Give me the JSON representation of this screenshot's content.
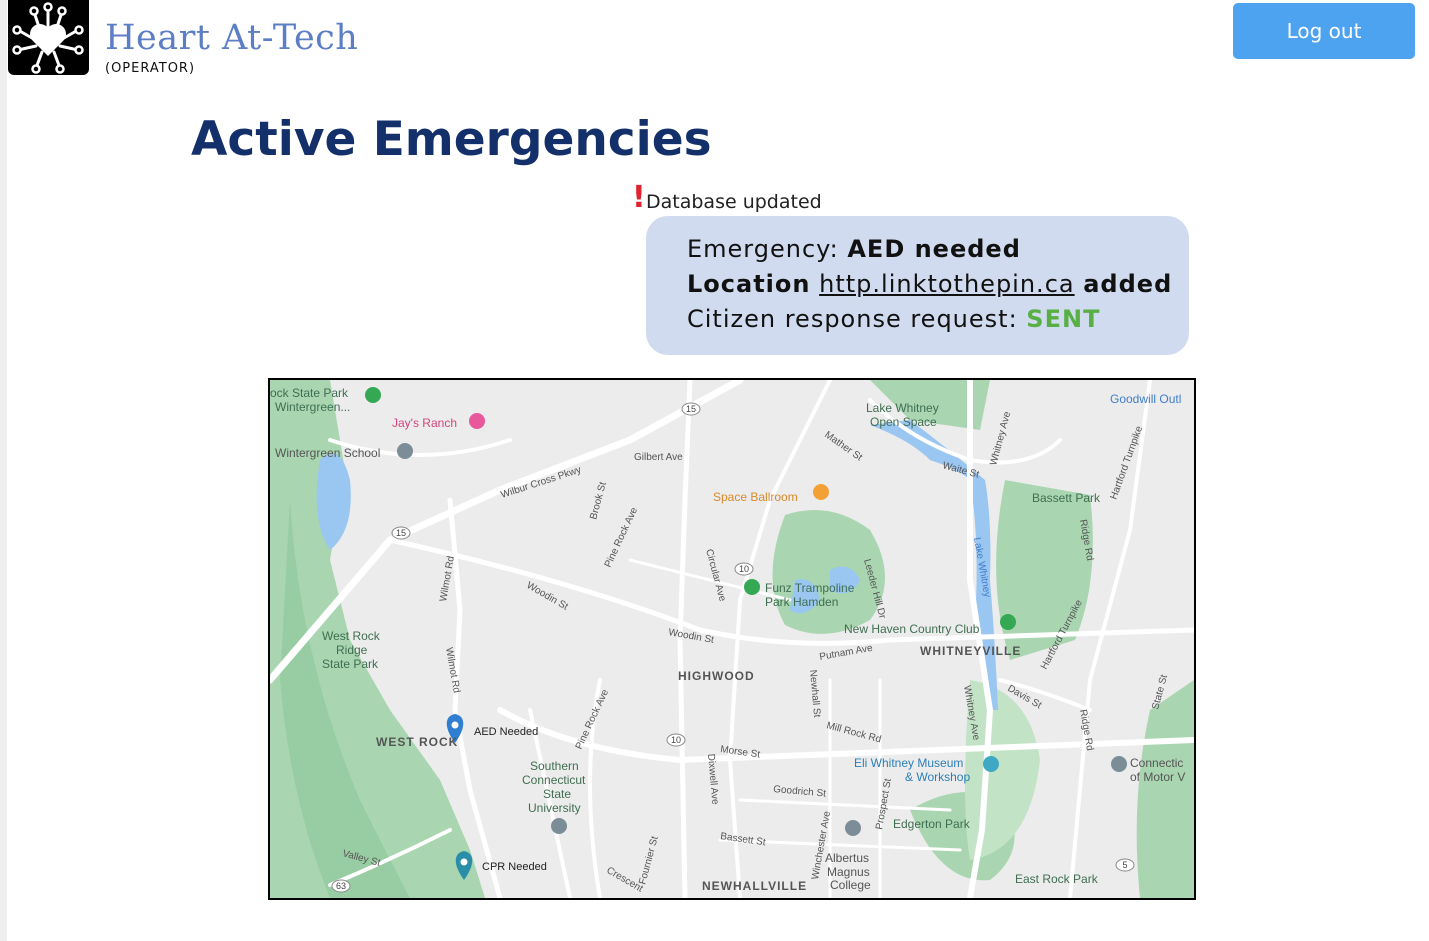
{
  "header": {
    "brand": "Heart At-Tech",
    "role": "(OPERATOR)",
    "logout_label": "Log out",
    "logo_icon": "circuit-heart-icon"
  },
  "page": {
    "title": "Active Emergencies"
  },
  "notice": {
    "icon": "exclamation-icon",
    "text": "Database updated"
  },
  "alert": {
    "emergency_label": "Emergency: ",
    "emergency_value": "AED needed",
    "location_label": "Location",
    "location_link": "http.linktothepin.ca",
    "location_suffix": "added",
    "citizen_label": "Citizen response request: ",
    "citizen_status": "SENT"
  },
  "colors": {
    "accent": "#4da3f0",
    "brand": "#5b7ec5",
    "title": "#14306b",
    "alert_bg": "#d1dbef",
    "sent": "#58b045",
    "warning": "#e0242f"
  },
  "map": {
    "labels": {
      "state_park": "ock State Park",
      "wintergreen": "Wintergreen...",
      "jays_ranch": "Jay's Ranch",
      "wintergreen_school": "Wintergreen School",
      "wilbur_cross": "Wilbur Cross Pkwy",
      "gilbert": "Gilbert Ave",
      "lake_whitney_1": "Lake Whitney",
      "lake_whitney_2": "Open Space",
      "goodwill": "Goodwill Outl",
      "mather": "Mather St",
      "waite": "Waite St",
      "whitney_ave": "Whitney Ave",
      "bassett_park": "Bassett Park",
      "hartford_1": "Hartford Turnpike",
      "space_ballroom": "Space Ballroom",
      "brook": "Brook St",
      "pine_rock_1": "Pine Rock Ave",
      "circular": "Circular Ave",
      "leeder": "Leeder Hill Dr",
      "lake_whitney_v": "Lake Whitney",
      "ridge_1": "Ridge Rd",
      "funz_1": "Funz Trampoline",
      "funz_2": "Park Hamden",
      "woodin_1": "Woodin St",
      "woodin_2": "Woodin St",
      "wilmot_1": "Wilmot Rd",
      "nhcc": "New Haven Country Club",
      "hartford_2": "Hartford Turnpike",
      "west_rock_1": "West Rock",
      "west_rock_2": "Ridge",
      "west_rock_3": "State Park",
      "putnam": "Putnam Ave",
      "whitneyville": "WHITNEYVILLE",
      "highwood": "HIGHWOOD",
      "wilmot_2": "Wilmot Rd",
      "newhall": "Newhall St",
      "davis": "Davis St",
      "state": "State St",
      "aed_pin": "AED Needed",
      "west_rock": "WEST ROCK",
      "pine_rock_2": "Pine Rock Ave",
      "mill_rock": "Mill Rock Rd",
      "whitney_ave_2": "Whitney Ave",
      "ridge_2": "Ridge Rd",
      "morse": "Morse St",
      "dixwell": "Dixwell Ave",
      "eli_1": "Eli Whitney Museum",
      "eli_2": "& Workshop",
      "connecticut_1": "Connectic",
      "connecticut_2": "of Motor V",
      "scsu_1": "Southern",
      "scsu_2": "Connecticut",
      "scsu_3": "State",
      "scsu_4": "University",
      "goodrich": "Goodrich St",
      "prospect": "Prospect St",
      "edgerton": "Edgerton Park",
      "bassett_st": "Bassett St",
      "winchester": "Winchester Ave",
      "fournier": "Fournier St",
      "albertus_1": "Albertus",
      "albertus_2": "Magnus",
      "albertus_3": "College",
      "valley": "Valley St",
      "cpr_pin": "CPR Needed",
      "crescent": "Crescent",
      "newhallville": "NEWHALLVILLE",
      "east_rock": "East Rock Park",
      "route_15a": "15",
      "route_15b": "15",
      "route_10a": "10",
      "route_10b": "10",
      "route_63": "63",
      "route_5": "5"
    }
  }
}
